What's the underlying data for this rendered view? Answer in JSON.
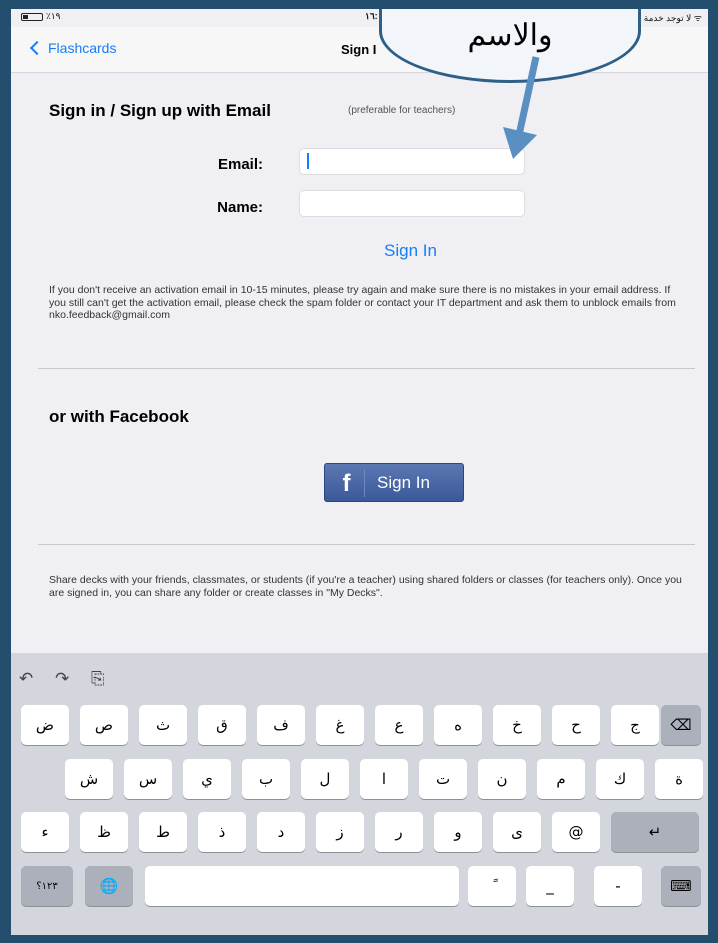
{
  "status_bar": {
    "battery_pct": "٪١٩",
    "time": "١٦:",
    "carrier": "لا توجد خدمة"
  },
  "nav": {
    "back_label": "Flashcards",
    "title": "Sign I"
  },
  "email_section": {
    "heading": "Sign in / Sign up with Email",
    "note": "(preferable for teachers)",
    "email_label": "Email:",
    "email_value": "",
    "name_label": "Name:",
    "name_value": "",
    "signin_label": "Sign In",
    "activation_info": "If you don't receive an activation email in 10-15 minutes, please try again and make sure there is no mistakes in your email address. If you still can't get the activation email, please check the spam folder or contact your IT department and ask them to unblock emails from nko.feedback@gmail.com"
  },
  "facebook_section": {
    "heading": "or with Facebook",
    "button_icon": "f",
    "button_label": "Sign In"
  },
  "share_info": "Share decks with your friends, classmates, or students (if you're a teacher) using shared folders or classes (for teachers only). Once you are signed in, you can share any folder or create classes in \"My Decks\".",
  "callout": {
    "text": "والاسم"
  },
  "keyboard": {
    "toolbar": [
      "↶",
      "↷",
      "⎘"
    ],
    "row1": [
      "ض",
      "ص",
      "ث",
      "ق",
      "ف",
      "غ",
      "ع",
      "ه",
      "خ",
      "ح",
      "ج",
      "⌫"
    ],
    "row2": [
      "ش",
      "س",
      "ي",
      "ب",
      "ل",
      "ا",
      "ت",
      "ن",
      "م",
      "ك",
      "ة"
    ],
    "row3": [
      "ء",
      "ظ",
      "ط",
      "ذ",
      "د",
      "ز",
      "ر",
      "و",
      "ى",
      "@",
      "↵"
    ],
    "row4": [
      "١٢٣؟",
      "🌐",
      "",
      "ً",
      "_",
      "-",
      "⌨"
    ]
  },
  "colors": {
    "accent": "#147efb",
    "facebook": "#3b5998",
    "frame": "#234e6d",
    "callout_border": "#2e5f86"
  }
}
